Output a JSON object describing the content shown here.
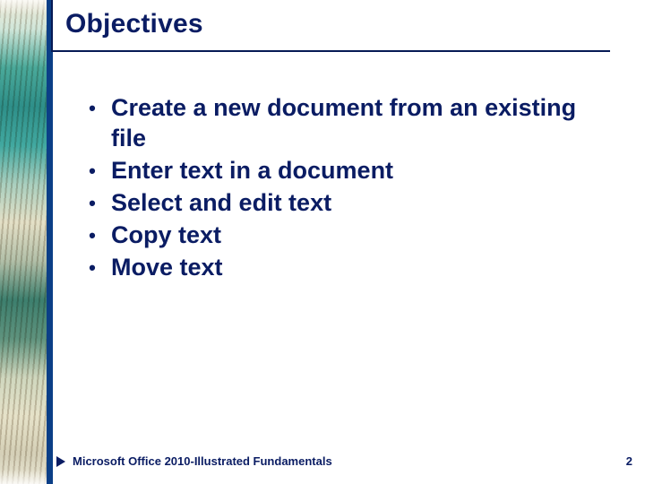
{
  "title": "Objectives",
  "bullets": [
    "Create a new document from an existing file",
    "Enter text in a document",
    "Select and edit text",
    "Copy text",
    "Move text"
  ],
  "footer": {
    "text": "Microsoft Office 2010-Illustrated Fundamentals",
    "page": "2"
  }
}
